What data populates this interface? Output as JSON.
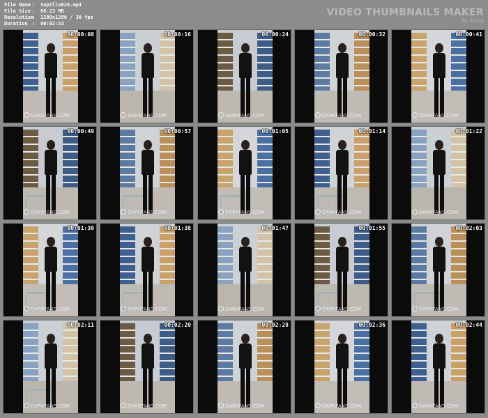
{
  "header": {
    "meta": [
      {
        "key": "File Name",
        "value": "SopXllo026.mp4"
      },
      {
        "key": "File Size",
        "value": "88.23 MB"
      },
      {
        "key": "Resolution",
        "value": "1280x1280 / 30 fps"
      },
      {
        "key": "Duration",
        "value": "00:02:53"
      }
    ],
    "separator": ":",
    "brand_title": "VIDEO THUMBNAILS MAKER",
    "brand_sub": "by Scorp"
  },
  "watermark": "DARKFANS.COM",
  "thumbnails": [
    {
      "timestamp": "00:00:08"
    },
    {
      "timestamp": "00:00:16"
    },
    {
      "timestamp": "00:00:24"
    },
    {
      "timestamp": "00:00:32"
    },
    {
      "timestamp": "00:00:41"
    },
    {
      "timestamp": "00:00:49"
    },
    {
      "timestamp": "00:00:57"
    },
    {
      "timestamp": "00:01:05"
    },
    {
      "timestamp": "00:01:14"
    },
    {
      "timestamp": "00:01:22"
    },
    {
      "timestamp": "00:01:30"
    },
    {
      "timestamp": "00:01:38"
    },
    {
      "timestamp": "00:01:47"
    },
    {
      "timestamp": "00:01:55"
    },
    {
      "timestamp": "00:02:03"
    },
    {
      "timestamp": "00:02:11"
    },
    {
      "timestamp": "00:02:20"
    },
    {
      "timestamp": "00:02:28"
    },
    {
      "timestamp": "00:02:36"
    },
    {
      "timestamp": "00:02:44"
    }
  ]
}
